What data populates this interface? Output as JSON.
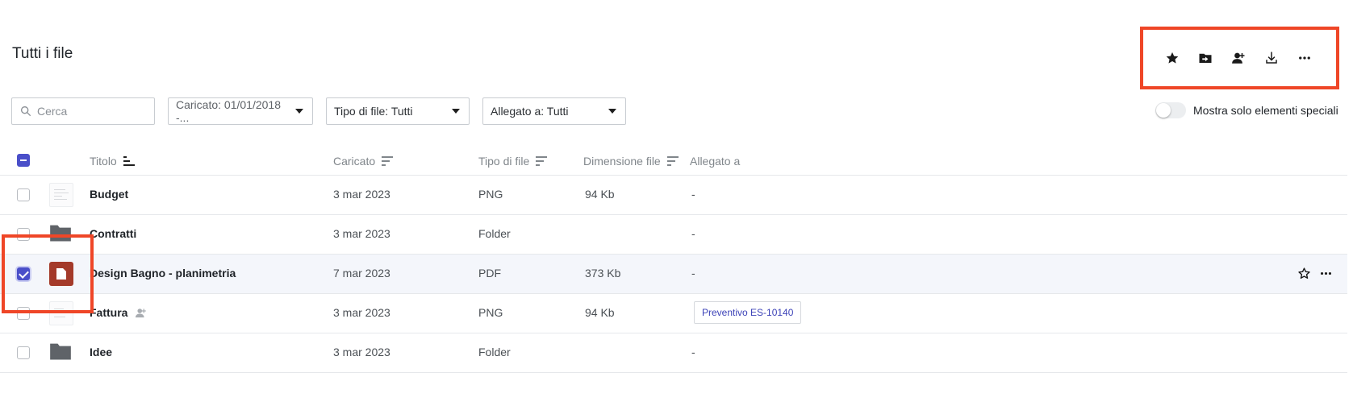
{
  "page": {
    "title": "Tutti i file"
  },
  "toolbar": {
    "actions": [
      {
        "name": "star-icon",
        "label": "Speciale"
      },
      {
        "name": "move-to-folder-icon",
        "label": "Sposta"
      },
      {
        "name": "share-user-icon",
        "label": "Condividi"
      },
      {
        "name": "download-icon",
        "label": "Scarica"
      },
      {
        "name": "more-icon",
        "label": "Altro"
      }
    ]
  },
  "filters": {
    "search_placeholder": "Cerca",
    "uploaded": "Caricato: 01/01/2018 -...",
    "file_type": "Tipo di file: Tutti",
    "attached_to": "Allegato a: Tutti"
  },
  "toggle": {
    "label": "Mostra solo elementi speciali",
    "on": false
  },
  "table": {
    "columns": {
      "title": "Titolo",
      "uploaded": "Caricato",
      "file_type": "Tipo di file",
      "size": "Dimensione file",
      "attached_to": "Allegato a"
    },
    "rows": [
      {
        "title": "Budget",
        "uploaded": "3 mar 2023",
        "type": "PNG",
        "size": "94 Kb",
        "attached": "-",
        "thumb": "doc",
        "checked": false
      },
      {
        "title": "Contratti",
        "uploaded": "3 mar 2023",
        "type": "Folder",
        "size": "",
        "attached": "-",
        "thumb": "folder",
        "checked": false
      },
      {
        "title": "Design Bagno - planimetria",
        "uploaded": "7 mar 2023",
        "type": "PDF",
        "size": "373 Kb",
        "attached": "-",
        "thumb": "pdf",
        "checked": true
      },
      {
        "title": "Fattura",
        "uploaded": "3 mar 2023",
        "type": "PNG",
        "size": "94 Kb",
        "attached": "Preventivo ES-10140",
        "thumb": "doc",
        "checked": false,
        "shared": true
      },
      {
        "title": "Idee",
        "uploaded": "3 mar 2023",
        "type": "Folder",
        "size": "",
        "attached": "-",
        "thumb": "folder",
        "checked": false
      }
    ]
  },
  "colors": {
    "accent": "#4a4fc9",
    "highlight": "#ef4627",
    "pdf": "#a43a2a",
    "link": "#3d43b8"
  }
}
